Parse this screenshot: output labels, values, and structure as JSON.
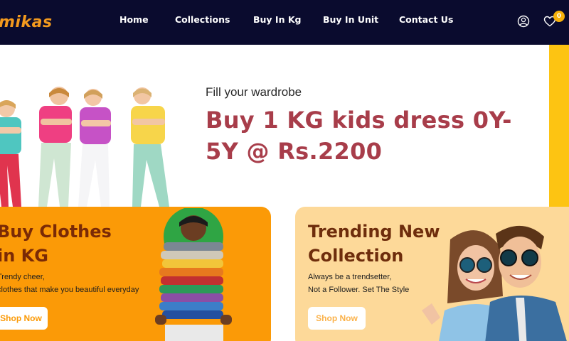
{
  "header": {
    "logo": "mikas",
    "nav": [
      "Home",
      "Collections",
      "Buy In Kg",
      "Buy In Unit",
      "Contact Us"
    ],
    "icons": [
      "user-icon",
      "heart-icon"
    ],
    "cart_count": "0"
  },
  "hero": {
    "subtitle": "Fill your wardrobe",
    "title": "Buy 1 KG kids dress 0Y-5Y @ Rs.2200"
  },
  "cards": [
    {
      "title": "Buy Clothes\nin KG",
      "text": "Trendy cheer,\nclothes that make you beautiful everyday",
      "button": "Shop Now"
    },
    {
      "title": "Trending New\nCollection",
      "text": "Always be a trendsetter,\nNot a Follower. Set The Style",
      "button": "Shop Now"
    }
  ],
  "colors": {
    "header_bg": "#0a0b2e",
    "logo": "#f39a1e",
    "hero_title": "#a83d4a",
    "accent_yellow": "#fdc412",
    "card_orange": "#fb9a07",
    "card_peach": "#fdd999"
  }
}
